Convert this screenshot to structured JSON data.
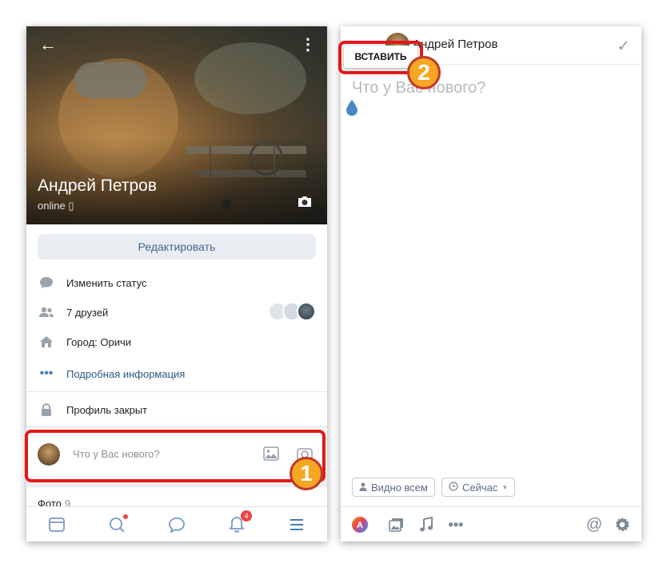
{
  "profile": {
    "name": "Андрей Петров",
    "online": "online"
  },
  "left": {
    "edit_button": "Редактировать",
    "info": {
      "status": "Изменить статус",
      "friends": "7 друзей",
      "city": "Город: Оричи",
      "details": "Подробная информация",
      "closed": "Профиль закрыт"
    },
    "compose": {
      "placeholder": "Что у Вас нового?"
    },
    "photos": {
      "label": "Фото",
      "count": "9"
    },
    "tabbar": {
      "notifications_badge": "4"
    }
  },
  "right": {
    "author": "Андрей Петров",
    "paste_label": "ВСТАВИТЬ",
    "placeholder": "Что у Вас нового?",
    "visibility": "Видно всем",
    "time": "Сейчас"
  },
  "callouts": {
    "one": "1",
    "two": "2"
  },
  "colors": {
    "accent": "#2a5885",
    "highlight": "#e11919",
    "badge": "#e64646"
  }
}
